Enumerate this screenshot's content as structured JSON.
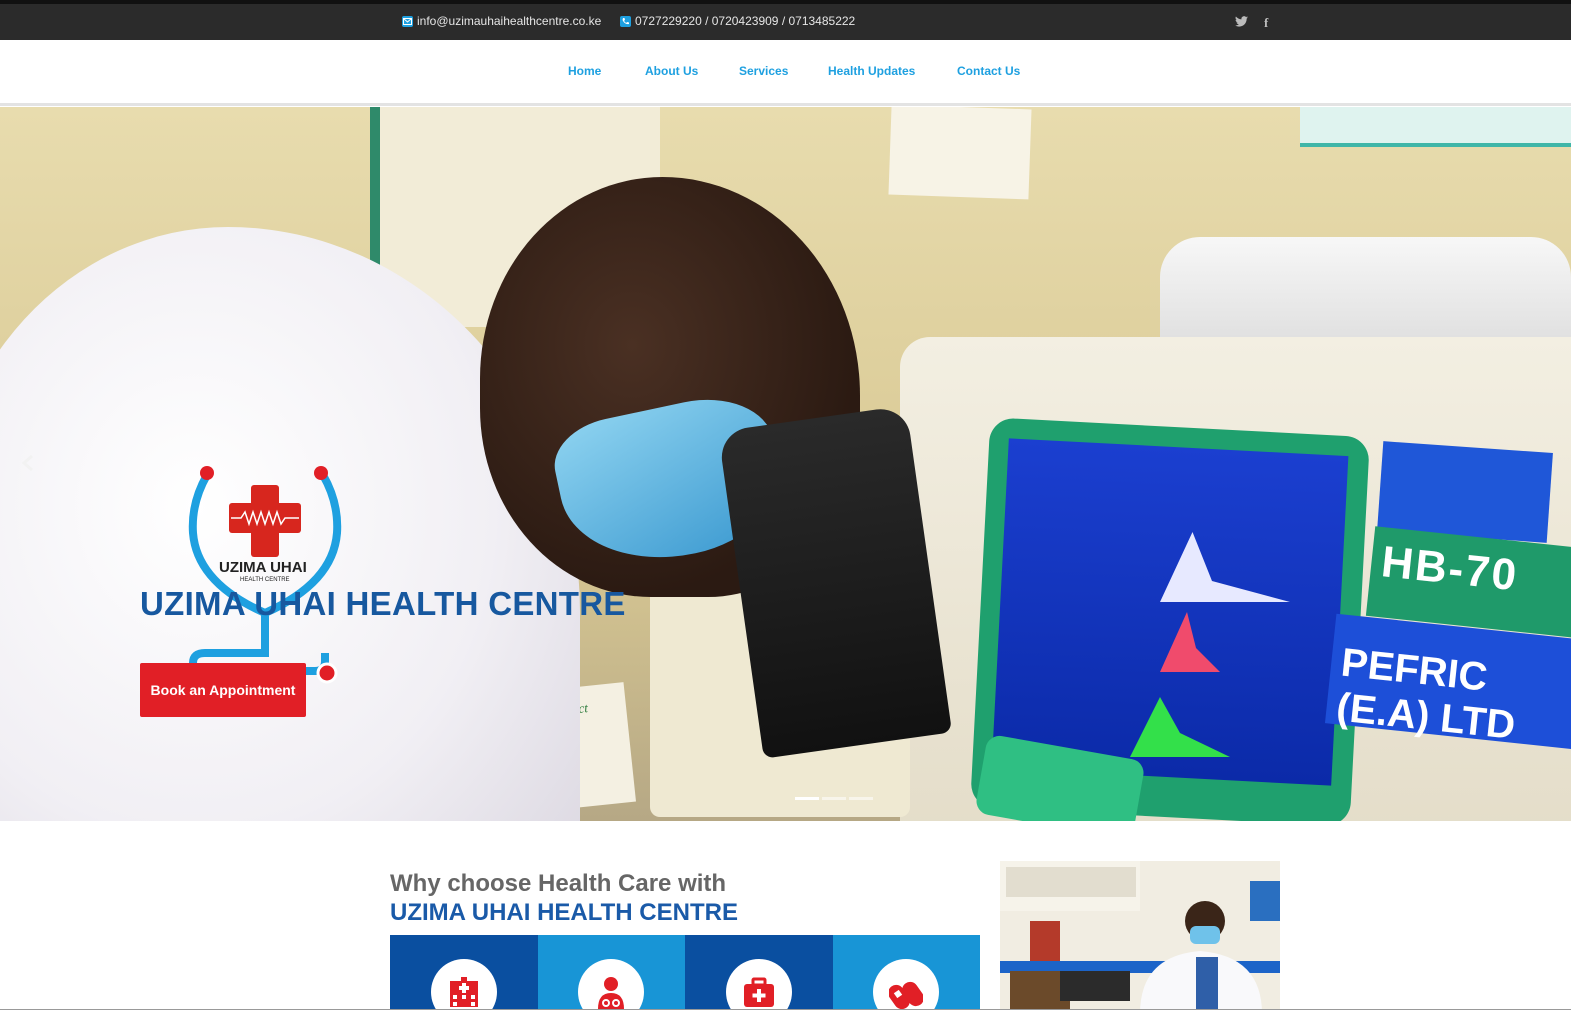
{
  "topbar": {
    "email": "info@uzimauhaihealthcentre.co.ke",
    "phone": "0727229220 / 0720423909 / 0713485222",
    "social": [
      {
        "icon": "twitter-icon",
        "glyph": "🐦"
      },
      {
        "icon": "facebook-icon",
        "glyph": "f"
      }
    ]
  },
  "nav": {
    "items": [
      "Home",
      "About Us",
      "Services",
      "Health Updates",
      "Contact Us"
    ]
  },
  "hero": {
    "logo_text": "UZIMA UHAI",
    "logo_subtext": "HEALTH CENTRE",
    "title": "UZIMA UHAI HEALTH CENTRE",
    "button_label": "Book an Appointment",
    "slide_count": 3,
    "active_slide": 1,
    "photo_labels": {
      "hb": "HB-70",
      "pefric": "PEFRIC (E.A) LTD",
      "box": "Fino-Ject"
    }
  },
  "why": {
    "line1": "Why choose Health Care with",
    "line2": "UZIMA UHAI HEALTH CENTRE",
    "features": [
      {
        "icon": "hospital-icon"
      },
      {
        "icon": "doctor-icon"
      },
      {
        "icon": "first-aid-kit-icon"
      },
      {
        "icon": "pills-icon"
      }
    ]
  },
  "colors": {
    "accent_blue": "#1ea0e0",
    "brand_navy": "#17589f",
    "button_red": "#e11f26",
    "topbar": "#2b2b2b"
  }
}
